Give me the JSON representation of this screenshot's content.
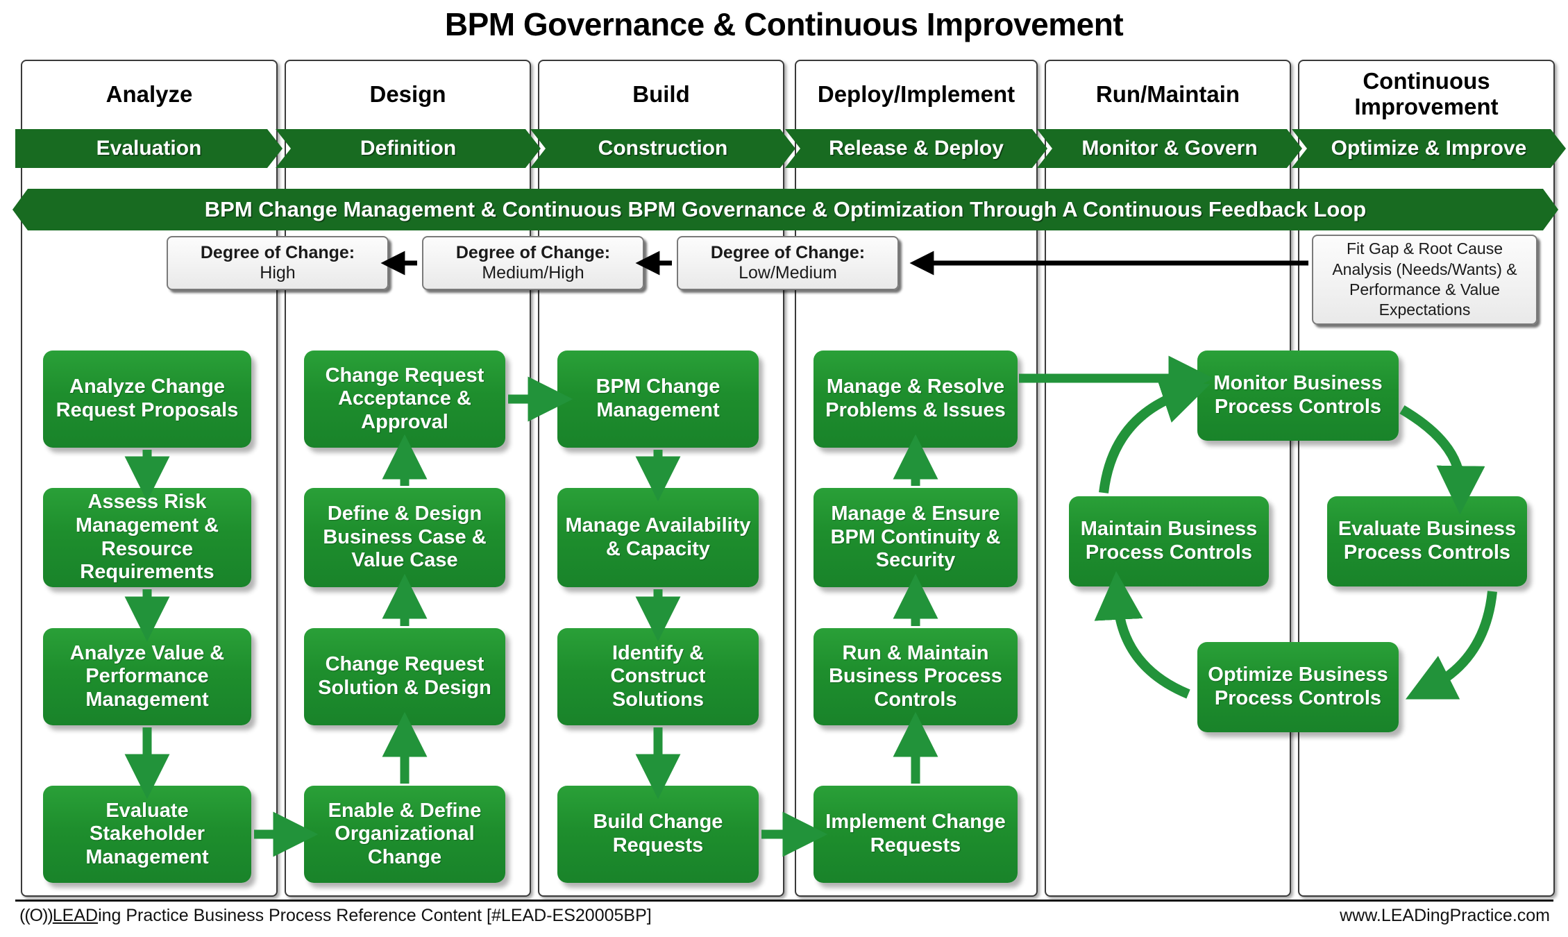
{
  "title": "BPM Governance & Continuous Improvement",
  "colors": {
    "chevron_green": "#186B21",
    "box_green": "#1E8E2D",
    "arrow_green": "#22933A",
    "panel_border": "#3a3a3a",
    "text_dark": "#111111"
  },
  "columns": [
    {
      "title": "Analyze",
      "phase": "Evaluation"
    },
    {
      "title": "Design",
      "phase": "Definition"
    },
    {
      "title": "Build",
      "phase": "Construction"
    },
    {
      "title": "Deploy/Implement",
      "phase": "Release & Deploy"
    },
    {
      "title": "Run/Maintain",
      "phase": "Monitor & Govern"
    },
    {
      "title": "Continuous Improvement",
      "phase": "Optimize & Improve"
    }
  ],
  "banner": "BPM Change Management & Continuous BPM Governance & Optimization Through A Continuous Feedback Loop",
  "degree_boxes": [
    {
      "label": "Degree of Change:",
      "value": "High"
    },
    {
      "label": "Degree of Change:",
      "value": "Medium/High"
    },
    {
      "label": "Degree of Change:",
      "value": "Low/Medium"
    }
  ],
  "analysis_box": "Fit Gap & Root Cause Analysis (Needs/Wants) & Performance & Value Expectations",
  "process_boxes": {
    "analyze": [
      "Analyze Change Request Proposals",
      "Assess Risk Management & Resource Requirements",
      "Analyze Value & Performance Management",
      "Evaluate Stakeholder Management"
    ],
    "design": [
      "Change Request Acceptance & Approval",
      "Define & Design Business Case & Value Case",
      "Change Request Solution & Design",
      "Enable & Define Organizational Change"
    ],
    "build": [
      "BPM Change Management",
      "Manage Availability & Capacity",
      "Identify & Construct Solutions",
      "Build Change Requests"
    ],
    "deploy": [
      "Manage & Resolve Problems & Issues",
      "Manage & Ensure BPM Continuity & Security",
      "Run & Maintain Business Process Controls",
      "Implement Change Requests"
    ],
    "cycle": [
      "Monitor Business Process Controls",
      "Evaluate Business Process Controls",
      "Optimize Business Process Controls",
      "Maintain Business Process Controls"
    ]
  },
  "footer": {
    "logo": "((O))",
    "left_underlined": "LEAD",
    "left_rest": "ing Practice Business Process Reference Content [#LEAD-ES20005BP]",
    "right": "www.LEADingPractice.com"
  }
}
